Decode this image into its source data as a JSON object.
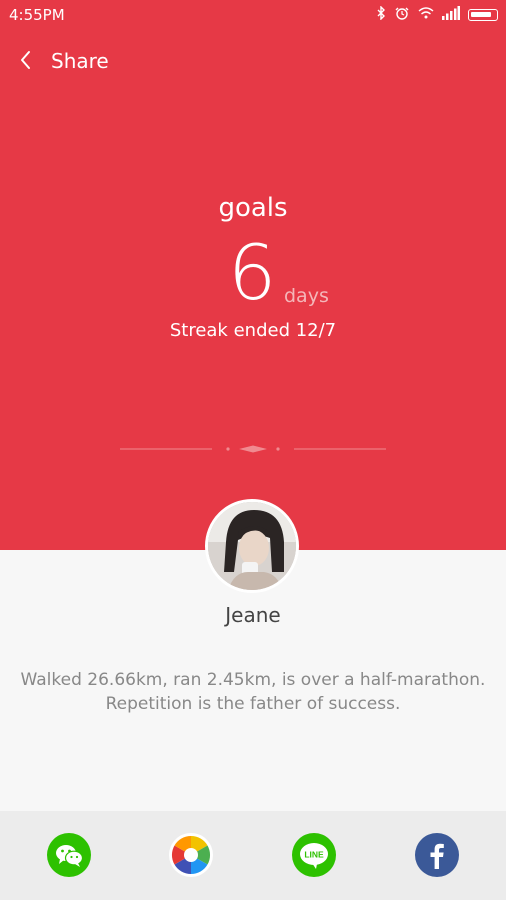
{
  "status_bar": {
    "time": "4:55PM"
  },
  "app_bar": {
    "title": "Share"
  },
  "goals": {
    "label": "goals",
    "count": "6",
    "unit": "days",
    "streak_text": "Streak ended 12/7"
  },
  "user": {
    "name": "Jeane"
  },
  "message": {
    "line1": "Walked 26.66km, ran 2.45km,  is over a half-marathon.",
    "line2": "Repetition is the father of success."
  },
  "share_targets": [
    {
      "icon": "wechat-icon",
      "color": "#2dc100"
    },
    {
      "icon": "moments-icon",
      "color": "#ffffff"
    },
    {
      "icon": "line-icon",
      "label": "LINE",
      "color": "#2dc100"
    },
    {
      "icon": "facebook-icon",
      "color": "#3b5998"
    }
  ],
  "colors": {
    "header_red": "#e63946",
    "background": "#f7f7f7",
    "sharebar": "#ececec"
  }
}
